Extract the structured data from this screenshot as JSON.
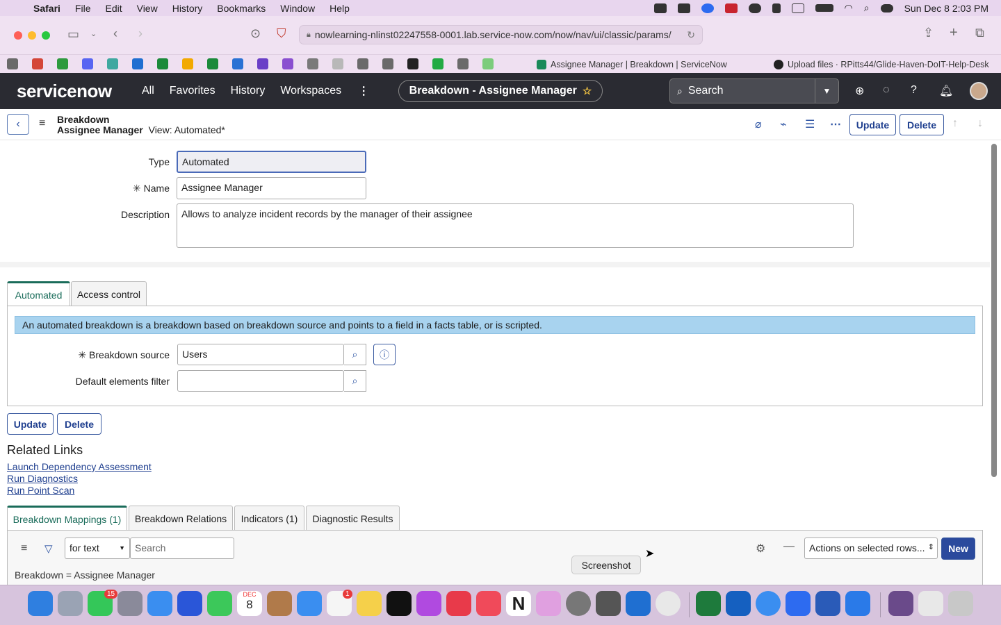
{
  "menubar": {
    "app": "Safari",
    "items": [
      "File",
      "Edit",
      "View",
      "History",
      "Bookmarks",
      "Window",
      "Help"
    ],
    "clock": "Sun Dec 8  2:03 PM"
  },
  "browser": {
    "url": "nowlearning-nlinst02247558-0001.lab.service-now.com/now/nav/ui/classic/params/",
    "tabs": [
      {
        "title": "Assignee Manager | Breakdown | ServiceNow",
        "favicon_color": "#1a8a5a"
      },
      {
        "title": "Upload files · RPitts44/Glide-Haven-DoIT-Help-Desk",
        "favicon_color": "#222222"
      }
    ],
    "bookmark_colors": [
      "#6a6a6a",
      "#d44638",
      "#2e9a3e",
      "#5865f2",
      "#3fa8a0",
      "#1f6fd1",
      "#1b8a3a",
      "#f2a900",
      "#1b8a3a",
      "#2a72d4",
      "#6a3fc7",
      "#8a4fd0",
      "#7a7a7a",
      "#b8b8b8",
      "#6a6a6a",
      "#6a6a6a",
      "#222222",
      "#22aa44",
      "#6a6a6a",
      "#7ccc7c"
    ]
  },
  "sn": {
    "logo": "servicenow",
    "nav": [
      "All",
      "Favorites",
      "History",
      "Workspaces"
    ],
    "context_pill": "Breakdown - Assignee Manager",
    "search_placeholder": "Search"
  },
  "form_header": {
    "title_line1": "Breakdown",
    "title_line2": "Assignee Manager",
    "view": "View: Automated*",
    "update_label": "Update",
    "delete_label": "Delete"
  },
  "form": {
    "type_label": "Type",
    "type_value": "Automated",
    "name_label": "Name",
    "name_value": "Assignee Manager",
    "description_label": "Description",
    "description_value": "Allows to analyze incident records by the manager of their assignee"
  },
  "section_tabs": [
    "Automated",
    "Access control"
  ],
  "automated": {
    "info": "An automated breakdown is a breakdown based on breakdown source and points to a field in a facts table, or is scripted.",
    "source_label": "Breakdown source",
    "source_value": "Users",
    "filter_label": "Default elements filter",
    "filter_value": ""
  },
  "bottom_buttons": {
    "update": "Update",
    "delete": "Delete"
  },
  "related_links": {
    "heading": "Related Links",
    "items": [
      "Launch Dependency Assessment",
      "Run Diagnostics",
      "Run Point Scan"
    ]
  },
  "related_tabs": [
    "Breakdown Mappings (1)",
    "Breakdown Relations",
    "Indicators (1)",
    "Diagnostic Results"
  ],
  "list_controls": {
    "search_field": "for text",
    "search_placeholder": "Search",
    "actions": "Actions on selected rows...",
    "new_label": "New",
    "breadcrumb": "Breakdown = Assignee Manager"
  },
  "tooltip": "Screenshot",
  "dock": {
    "calendar_month": "DEC",
    "calendar_day": "8",
    "messages_badge": "15",
    "reminders_badge": "1",
    "icon_colors": [
      "#2f7fe0",
      "#9aa3b4",
      "#34c759",
      "#8a8a9a",
      "#3a8ef0",
      "#2a56d8",
      "#3cc85a",
      "#ffffff",
      "#b07a4a",
      "#3a8ef0",
      "#f5f5f5",
      "#f5d04a",
      "#111111",
      "#b04ae0",
      "#e83a4a",
      "#f04a5a",
      "#ffffff",
      "#e0a0e0",
      "#777777",
      "#555555",
      "#1f6fd1",
      "#e8e8e8",
      "#1e7a3c",
      "#1560c0",
      "#3a8ef0",
      "#2d6bf0",
      "#2a5bb8",
      "#2a7ae8",
      "#6a4a8a",
      "#e8e8e8",
      "#c8c8c8"
    ]
  }
}
